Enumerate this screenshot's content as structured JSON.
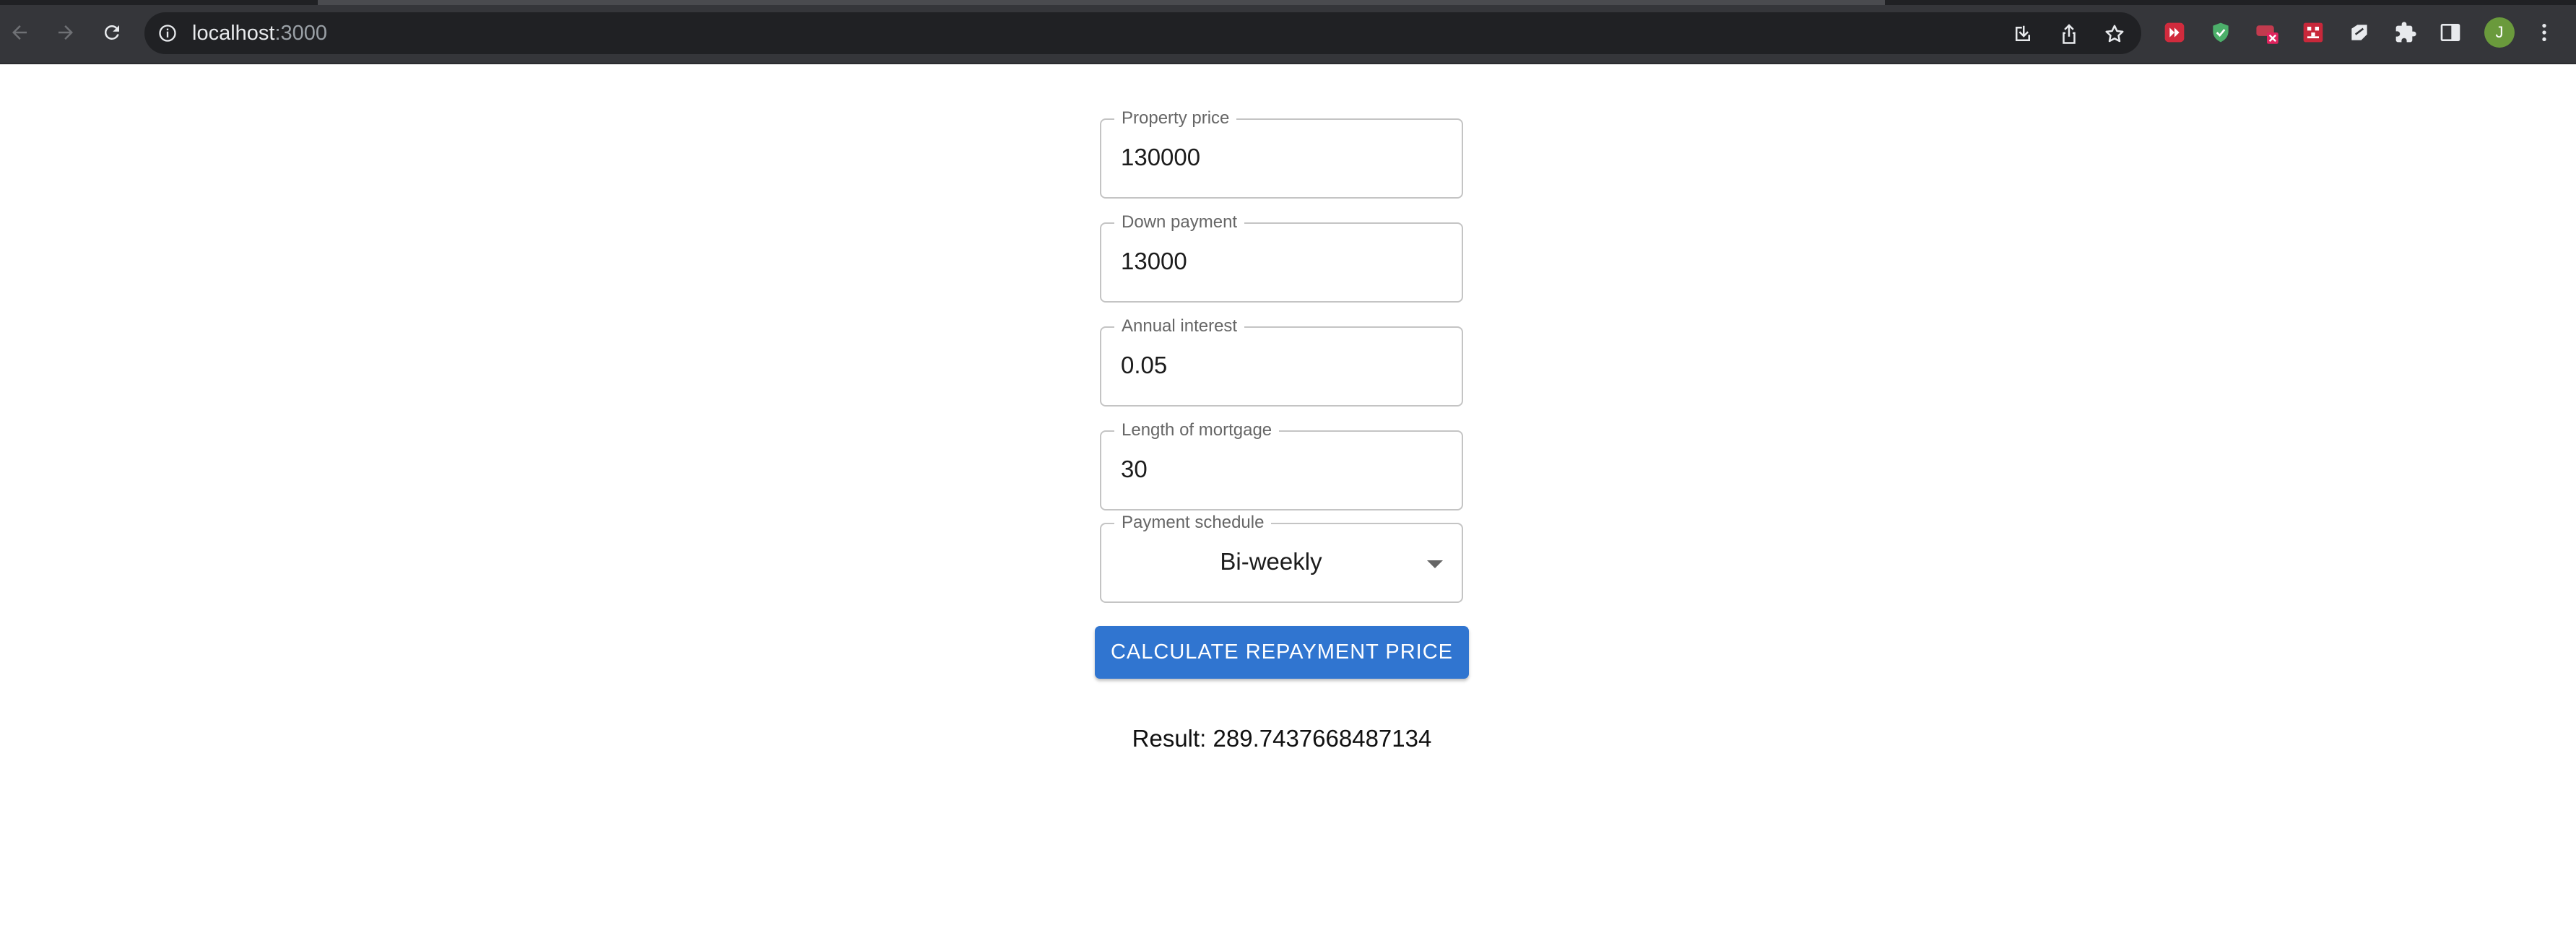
{
  "browser": {
    "url_host": "localhost",
    "url_port": ":3000",
    "profile_initial": "J",
    "icons": {
      "back": "arrow-left-icon",
      "forward": "arrow-right-icon",
      "reload": "reload-icon",
      "site_info": "info-icon",
      "install": "install-app-icon",
      "share": "share-icon",
      "bookmark": "star-icon",
      "extensions": "puzzle-icon",
      "side_panel": "side-panel-icon",
      "menu": "kebab-menu-icon"
    },
    "colors": {
      "chrome_bg": "#35363a",
      "omnibox_bg": "#202124",
      "avatar_bg": "#6a9a3c"
    }
  },
  "form": {
    "property_price": {
      "label": "Property price",
      "value": "130000"
    },
    "down_payment": {
      "label": "Down payment",
      "value": "13000"
    },
    "annual_interest": {
      "label": "Annual interest",
      "value": "0.05"
    },
    "mortgage_length": {
      "label": "Length of mortgage",
      "value": "30"
    },
    "payment_schedule": {
      "label": "Payment schedule",
      "value": "Bi-weekly"
    },
    "calculate_button": "CALCULATE REPAYMENT PRICE",
    "result": "Result: 289.7437668487134",
    "accent_color": "#3075d0"
  }
}
